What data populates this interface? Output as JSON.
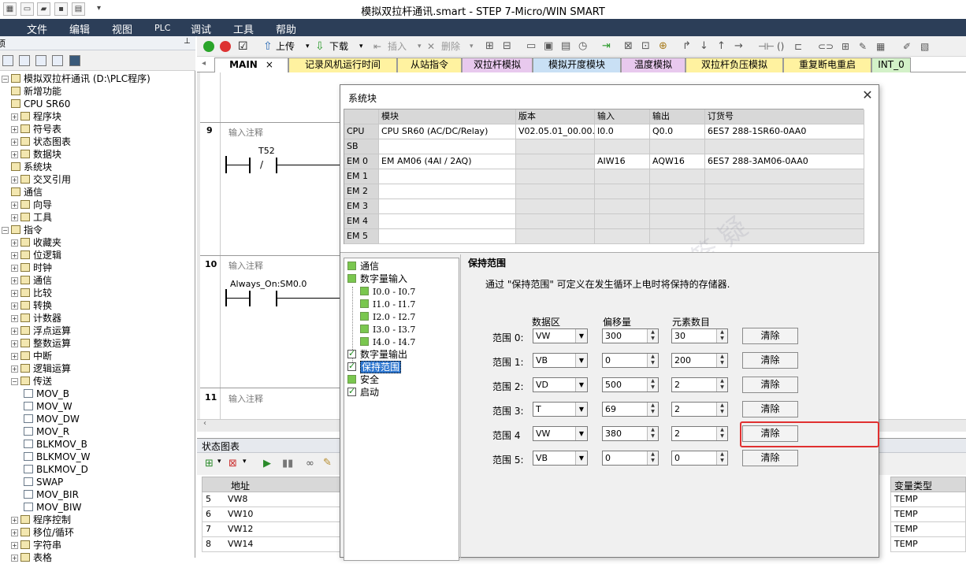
{
  "window": {
    "title": "模拟双拉杆通讯.smart - STEP 7-Micro/WIN SMART"
  },
  "menu": [
    "文件",
    "编辑",
    "视图",
    "PLC",
    "调试",
    "工具",
    "帮助"
  ],
  "left_panel": {
    "header": "项",
    "tree": [
      {
        "label": "模拟双拉杆通讯 (D:\\PLC程序)",
        "level": 0,
        "exp": "−"
      },
      {
        "label": "新增功能",
        "level": 1,
        "exp": ""
      },
      {
        "label": "CPU SR60",
        "level": 1,
        "exp": ""
      },
      {
        "label": "程序块",
        "level": 1,
        "exp": "+"
      },
      {
        "label": "符号表",
        "level": 1,
        "exp": "+"
      },
      {
        "label": "状态图表",
        "level": 1,
        "exp": "+"
      },
      {
        "label": "数据块",
        "level": 1,
        "exp": "+"
      },
      {
        "label": "系统块",
        "level": 1,
        "exp": ""
      },
      {
        "label": "交叉引用",
        "level": 1,
        "exp": "+"
      },
      {
        "label": "通信",
        "level": 1,
        "exp": ""
      },
      {
        "label": "向导",
        "level": 1,
        "exp": "+"
      },
      {
        "label": "工具",
        "level": 1,
        "exp": "+"
      },
      {
        "label": "指令",
        "level": 0,
        "exp": "−"
      },
      {
        "label": "收藏夹",
        "level": 1,
        "exp": "+"
      },
      {
        "label": "位逻辑",
        "level": 1,
        "exp": "+"
      },
      {
        "label": "时钟",
        "level": 1,
        "exp": "+"
      },
      {
        "label": "通信",
        "level": 1,
        "exp": "+"
      },
      {
        "label": "比较",
        "level": 1,
        "exp": "+"
      },
      {
        "label": "转换",
        "level": 1,
        "exp": "+"
      },
      {
        "label": "计数器",
        "level": 1,
        "exp": "+"
      },
      {
        "label": "浮点运算",
        "level": 1,
        "exp": "+"
      },
      {
        "label": "整数运算",
        "level": 1,
        "exp": "+"
      },
      {
        "label": "中断",
        "level": 1,
        "exp": "+"
      },
      {
        "label": "逻辑运算",
        "level": 1,
        "exp": "+"
      },
      {
        "label": "传送",
        "level": 1,
        "exp": "−"
      },
      {
        "label": "MOV_B",
        "level": 2,
        "exp": ""
      },
      {
        "label": "MOV_W",
        "level": 2,
        "exp": ""
      },
      {
        "label": "MOV_DW",
        "level": 2,
        "exp": ""
      },
      {
        "label": "MOV_R",
        "level": 2,
        "exp": ""
      },
      {
        "label": "BLKMOV_B",
        "level": 2,
        "exp": ""
      },
      {
        "label": "BLKMOV_W",
        "level": 2,
        "exp": ""
      },
      {
        "label": "BLKMOV_D",
        "level": 2,
        "exp": ""
      },
      {
        "label": "SWAP",
        "level": 2,
        "exp": ""
      },
      {
        "label": "MOV_BIR",
        "level": 2,
        "exp": ""
      },
      {
        "label": "MOV_BIW",
        "level": 2,
        "exp": ""
      },
      {
        "label": "程序控制",
        "level": 1,
        "exp": "+"
      },
      {
        "label": "移位/循环",
        "level": 1,
        "exp": "+"
      },
      {
        "label": "字符串",
        "level": 1,
        "exp": "+"
      },
      {
        "label": "表格",
        "level": 1,
        "exp": "+"
      }
    ]
  },
  "toolbar": {
    "upload": "上传",
    "download": "下载",
    "insert": "插入",
    "delete": "删除"
  },
  "tabs": [
    {
      "label": "MAIN",
      "color": "#ffffff",
      "close": "×"
    },
    {
      "label": "记录风机运行时间",
      "color": "#fff2a0"
    },
    {
      "label": "从站指令",
      "color": "#fff2a0"
    },
    {
      "label": "双拉杆模拟",
      "color": "#e8c9ee"
    },
    {
      "label": "模拟开度模块",
      "color": "#c9e0f5"
    },
    {
      "label": "温度模拟",
      "color": "#e8c9ee"
    },
    {
      "label": "双拉杆负压模拟",
      "color": "#fff2a0"
    },
    {
      "label": "重复断电重启",
      "color": "#fff2a0"
    },
    {
      "label": "INT_0",
      "color": "#d3f1c8"
    }
  ],
  "editor": {
    "networks": [
      {
        "num": "9",
        "comment": "输入注释",
        "contact": "T52",
        "neg": "/"
      },
      {
        "num": "10",
        "comment": "输入注释",
        "contact": "Always_On:SM0.0",
        "neg": ""
      },
      {
        "num": "11",
        "comment": "输入注释",
        "contact": "",
        "neg": ""
      }
    ]
  },
  "status_panel": {
    "title": "状态图表",
    "col_address": "地址",
    "col_var_type": "变量类型",
    "rows": [
      {
        "n": "5",
        "addr": "VW8",
        "type": "TEMP"
      },
      {
        "n": "6",
        "addr": "VW10",
        "type": "TEMP"
      },
      {
        "n": "7",
        "addr": "VW12",
        "type": "TEMP"
      },
      {
        "n": "8",
        "addr": "VW14",
        "type": "TEMP"
      }
    ]
  },
  "dialog": {
    "title": "系统块",
    "close": "✕",
    "table": {
      "headers": [
        "模块",
        "版本",
        "输入",
        "输出",
        "订货号"
      ],
      "rows": [
        {
          "slot": "CPU",
          "module": "CPU SR60 (AC/DC/Relay)",
          "version": "V02.05.01_00.00...",
          "input": "I0.0",
          "output": "Q0.0",
          "order": "6ES7 288-1SR60-0AA0"
        },
        {
          "slot": "SB",
          "module": "",
          "version": "",
          "input": "",
          "output": "",
          "order": ""
        },
        {
          "slot": "EM 0",
          "module": "EM AM06 (4AI / 2AQ)",
          "version": "",
          "input": "AIW16",
          "output": "AQW16",
          "order": "6ES7 288-3AM06-0AA0"
        },
        {
          "slot": "EM 1",
          "module": "",
          "version": "",
          "input": "",
          "output": "",
          "order": ""
        },
        {
          "slot": "EM 2",
          "module": "",
          "version": "",
          "input": "",
          "output": "",
          "order": ""
        },
        {
          "slot": "EM 3",
          "module": "",
          "version": "",
          "input": "",
          "output": "",
          "order": ""
        },
        {
          "slot": "EM 4",
          "module": "",
          "version": "",
          "input": "",
          "output": "",
          "order": ""
        },
        {
          "slot": "EM 5",
          "module": "",
          "version": "",
          "input": "",
          "output": "",
          "order": ""
        }
      ]
    },
    "nav": [
      {
        "label": "通信",
        "level": 0,
        "check": "green"
      },
      {
        "label": "数字量输入",
        "level": 0,
        "check": "green"
      },
      {
        "label": "I0.0 - I0.7",
        "level": 1,
        "check": "green"
      },
      {
        "label": "I1.0 - I1.7",
        "level": 1,
        "check": "green"
      },
      {
        "label": "I2.0 - I2.7",
        "level": 1,
        "check": "green"
      },
      {
        "label": "I3.0 - I3.7",
        "level": 1,
        "check": "green"
      },
      {
        "label": "I4.0 - I4.7",
        "level": 1,
        "check": "green"
      },
      {
        "label": "数字量输出",
        "level": 0,
        "check": "checked"
      },
      {
        "label": "保持范围",
        "level": 0,
        "check": "checked",
        "selected": true
      },
      {
        "label": "安全",
        "level": 0,
        "check": "green"
      },
      {
        "label": "启动",
        "level": 0,
        "check": "checked"
      }
    ],
    "retentive": {
      "heading": "保持范围",
      "description": "通过 \"保持范围\" 可定义在发生循环上电时将保持的存储器.",
      "col_area": "数据区",
      "col_offset": "偏移量",
      "col_count": "元素数目",
      "clear_label": "清除",
      "ranges": [
        {
          "label": "范围 0:",
          "area": "VW",
          "offset": "300",
          "count": "30"
        },
        {
          "label": "范围 1:",
          "area": "VB",
          "offset": "0",
          "count": "200"
        },
        {
          "label": "范围 2:",
          "area": "VD",
          "offset": "500",
          "count": "2"
        },
        {
          "label": "范围 3:",
          "area": "T",
          "offset": "69",
          "count": "2"
        },
        {
          "label": "范围 4",
          "area": "VW",
          "offset": "380",
          "count": "2"
        },
        {
          "label": "范围 5:",
          "area": "VB",
          "offset": "0",
          "count": "0"
        }
      ]
    }
  }
}
